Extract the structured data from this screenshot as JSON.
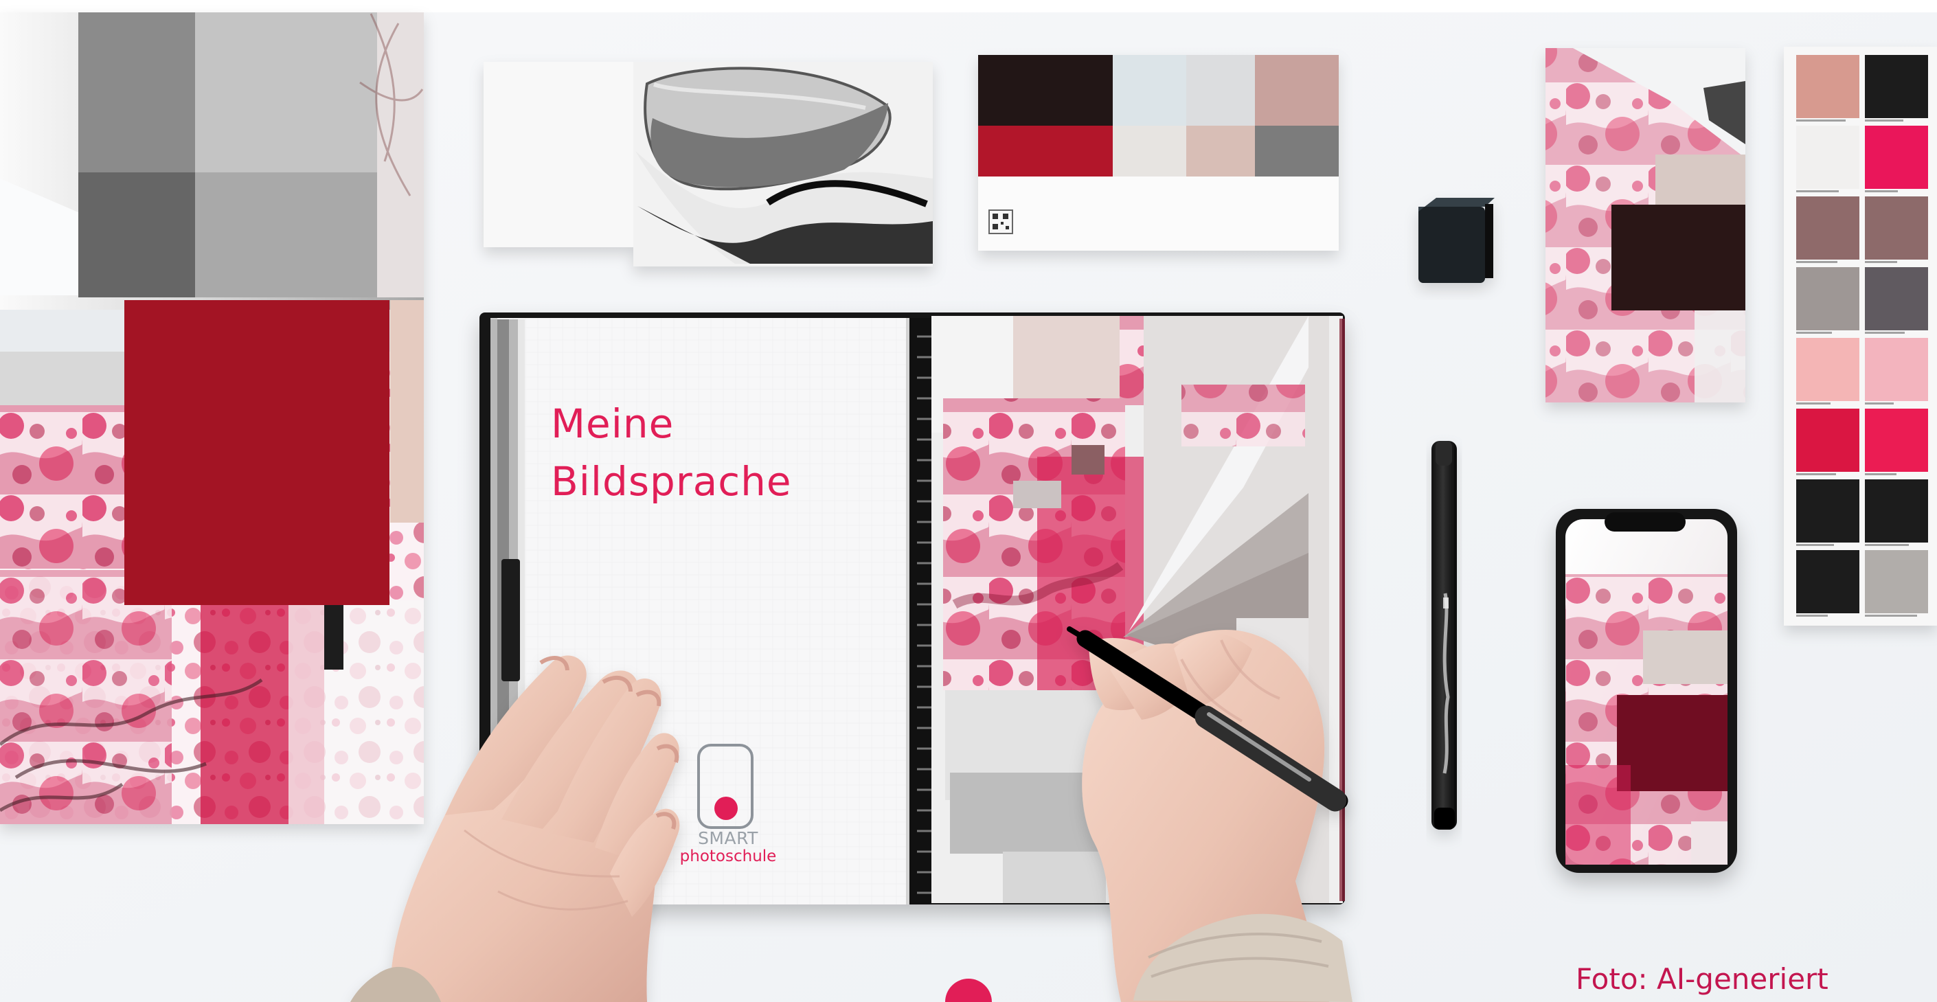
{
  "image": {
    "notebook_title": [
      "Meine",
      "Bildsprache"
    ],
    "logo": {
      "brand": "SMART",
      "school": "photoschule"
    },
    "caption": "Foto: AI-generiert",
    "colors": {
      "background": "#F3F5F7",
      "crimson": "#A31424",
      "pink_accent": "#E11E57",
      "dark_swatch": "#221718",
      "caption_text": "#C3164F"
    },
    "palette_colors": [
      "#D79A8F",
      "#1E1C1E",
      "#F1F0EF",
      "#EA175A",
      "#8F6A6A",
      "#8D6B6B",
      "#9E9795",
      "#605A60",
      "#F4B5B5",
      "#F3B4BE",
      "#DA1743",
      "#EB1C52",
      "#1C1C1E",
      "#1B1B1D",
      "#1C1C1F",
      "#B1ADAA"
    ],
    "icons": [
      "pen-icon",
      "phone-icon",
      "qr-code-icon"
    ]
  }
}
